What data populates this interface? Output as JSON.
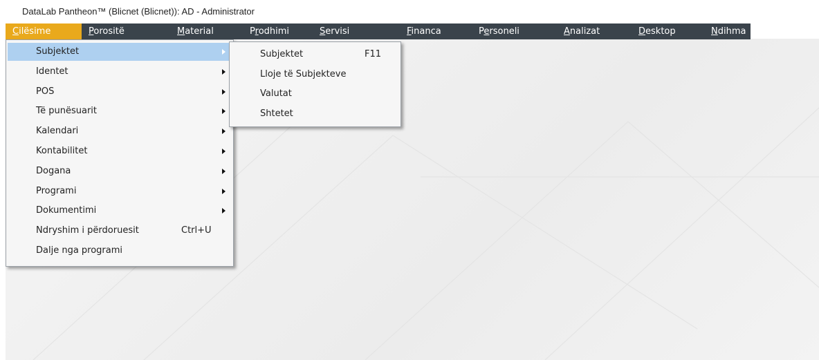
{
  "window": {
    "title": "DataLab Pantheon™  (Blicnet (Blicnet)): AD - Administrator"
  },
  "menubar": {
    "items": [
      {
        "label": "Cilësime",
        "mnemonic": "C",
        "active": true
      },
      {
        "label": "Porositë",
        "mnemonic": "P"
      },
      {
        "label": "Material",
        "mnemonic": "M"
      },
      {
        "label": "Prodhimi",
        "mnemonic": "r"
      },
      {
        "label": "Servisi",
        "mnemonic": "S"
      },
      {
        "label": "Financa",
        "mnemonic": "F"
      },
      {
        "label": "Personeli",
        "mnemonic": "e"
      },
      {
        "label": "Analizat",
        "mnemonic": "A"
      },
      {
        "label": "Desktop",
        "mnemonic": "D"
      },
      {
        "label": "Ndihma",
        "mnemonic": "N"
      }
    ]
  },
  "dropdown": {
    "items": [
      {
        "label": "Subjektet",
        "submenu": true,
        "highlighted": true
      },
      {
        "label": "Identet",
        "submenu": true
      },
      {
        "label": "POS",
        "submenu": true
      },
      {
        "label": "Të punësuarit",
        "submenu": true
      },
      {
        "label": "Kalendari",
        "submenu": true
      },
      {
        "label": "Kontabilitet",
        "submenu": true
      },
      {
        "label": "Dogana",
        "submenu": true
      },
      {
        "label": "Programi",
        "submenu": true
      },
      {
        "label": "Dokumentimi",
        "submenu": true
      },
      {
        "label": "Ndryshim i përdoruesit",
        "shortcut": "Ctrl+U"
      },
      {
        "label": "Dalje nga programi"
      }
    ]
  },
  "submenu": {
    "items": [
      {
        "label": "Subjektet",
        "shortcut": "F11"
      },
      {
        "label": "Lloje të Subjekteve"
      },
      {
        "label": "Valutat"
      },
      {
        "label": "Shtetet"
      }
    ]
  },
  "colors": {
    "menubar_bg": "#3a434b",
    "menu_active": "#e9a91c",
    "item_highlight": "#aed0f0"
  }
}
